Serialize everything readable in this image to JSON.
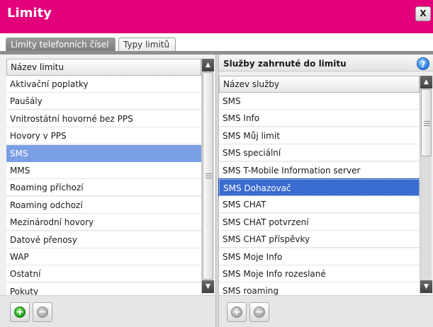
{
  "window": {
    "title": "Limity",
    "close_label": "X"
  },
  "tabs": [
    {
      "label": "Limity telefonních čísel",
      "active": true
    },
    {
      "label": "Typy limitů",
      "active": false
    }
  ],
  "left_list": {
    "column_header": "Název limitu",
    "items": [
      "Aktivační poplatky",
      "Paušály",
      "Vnitrostátní hovorné bez PPS",
      "Hovory v PPS",
      "SMS",
      "MMS",
      "Roaming příchozí",
      "Roaming odchozí",
      "Mezinárodní hovory",
      "Datové přenosy",
      "WAP",
      "Ostatní",
      "Pokuty"
    ],
    "selected_item": "SMS"
  },
  "right_panel": {
    "section_title": "Služby zahrnuté do limitu",
    "column_header": "Název služby",
    "items": [
      "SMS",
      "SMS Info",
      "SMS Můj limit",
      "SMS speciální",
      "SMS T-Mobile Information server",
      "SMS Dohazovač",
      "SMS CHAT",
      "SMS CHAT potvrzení",
      "SMS CHAT příspěvky",
      "SMS Moje Info",
      "SMS Moje Info rozeslané",
      "SMS roaming"
    ],
    "selected_item": "SMS Dohazovač"
  },
  "icons": {
    "add": "plus-icon",
    "remove": "minus-icon",
    "help": "help-icon",
    "help_glyph": "?"
  },
  "colors": {
    "brand": "#e2007a",
    "left_selection": "#7b9fe4",
    "right_selection": "#3a6bd1",
    "add_button_green": "#1f9a19"
  }
}
